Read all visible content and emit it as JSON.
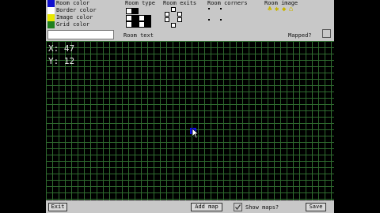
{
  "toolbar": {
    "colors": [
      {
        "label": "Room color",
        "swatch": "#1010d0"
      },
      {
        "label": "Border color",
        "swatch": "#ffffff"
      },
      {
        "label": "Image color",
        "swatch": "#e8e800"
      },
      {
        "label": "Grid color",
        "swatch": "#208020"
      }
    ],
    "room_type_label": "Room type",
    "room_exits_label": "Room exits",
    "room_corners_label": "Room corners",
    "room_image_label": "Room image",
    "room_text_label": "Room text",
    "mapped_label": "Mapped?",
    "room_text_value": ""
  },
  "map": {
    "x_text": "X: 47",
    "y_text": "Y: 12",
    "grid_color": "#2f6b2f",
    "selected_color": "#1010e0"
  },
  "bottombar": {
    "exit_label": "Exit",
    "add_map_label": "Add map",
    "show_maps_label": "Show maps?",
    "save_label": "Save",
    "show_maps_checked": true
  }
}
